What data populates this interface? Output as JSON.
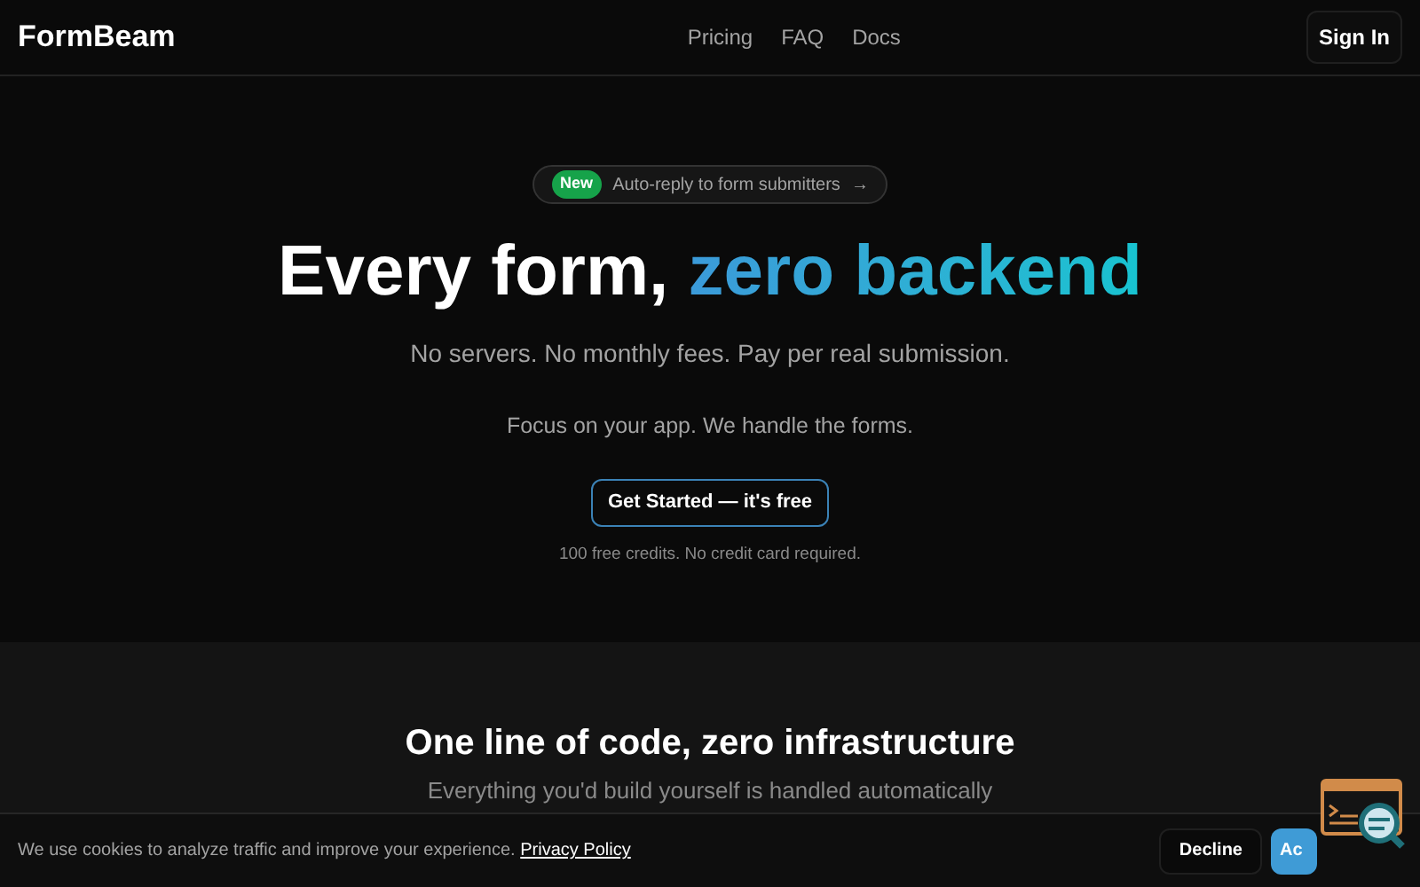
{
  "header": {
    "logo": "FormBeam",
    "nav": [
      "Pricing",
      "FAQ",
      "Docs"
    ],
    "sign_in": "Sign In"
  },
  "hero": {
    "announcement": {
      "badge": "New",
      "text": "Auto-reply to form submitters",
      "arrow": "→"
    },
    "title": "Every form,",
    "title_accent": "zero backend",
    "subtitle": "No servers. No monthly fees. Pay per real submission.",
    "tagline": "Focus on your app. We handle the forms.",
    "cta": "Get Started — it's free",
    "note": "100 free credits. No credit card required."
  },
  "features": {
    "title": "One line of code, zero infrastructure",
    "subtitle": "Everything you'd build yourself is handled automatically"
  },
  "cookie_banner": {
    "text": "We use cookies to analyze traffic and improve your experience.",
    "link": "Privacy Policy",
    "decline": "Decline",
    "accept": "Ac"
  }
}
